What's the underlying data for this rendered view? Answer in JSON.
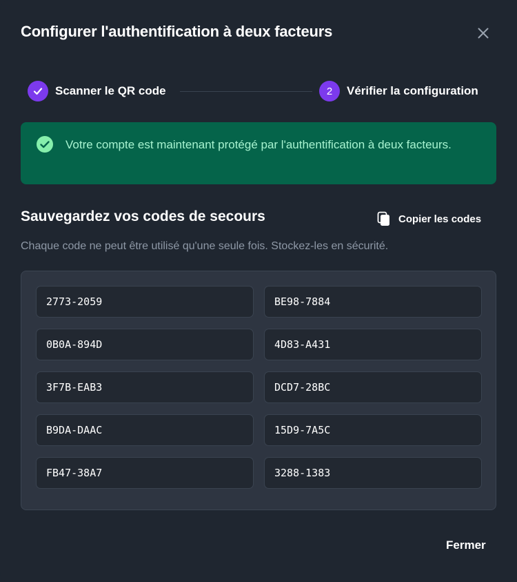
{
  "dialog": {
    "title": "Configurer l'authentification à deux facteurs"
  },
  "stepper": {
    "steps": [
      {
        "label": "Scanner le QR code",
        "state": "completed",
        "icon": "check-icon"
      },
      {
        "label": "Vérifier la configuration",
        "state": "current",
        "number": "2"
      }
    ]
  },
  "alert": {
    "type": "success",
    "icon": "check-circle-icon",
    "message": "Votre compte est maintenant protégé par l'authentification à deux facteurs."
  },
  "backup": {
    "title": "Sauvegardez vos codes de secours",
    "copy_label": "Copier les codes",
    "description": "Chaque code ne peut être utilisé qu'une seule fois. Stockez-les en sécurité.",
    "codes": [
      "2773-2059",
      "BE98-7884",
      "0B0A-894D",
      "4D83-A431",
      "3F7B-EAB3",
      "DCD7-28BC",
      "B9DA-DAAC",
      "15D9-7A5C",
      "FB47-38A7",
      "3288-1383"
    ]
  },
  "footer": {
    "close_label": "Fermer"
  },
  "colors": {
    "background": "#1f2630",
    "accent": "#7c3aed",
    "success_bg": "#05644a",
    "success_text": "#a7f3d0",
    "success_icon": "#86efac"
  }
}
